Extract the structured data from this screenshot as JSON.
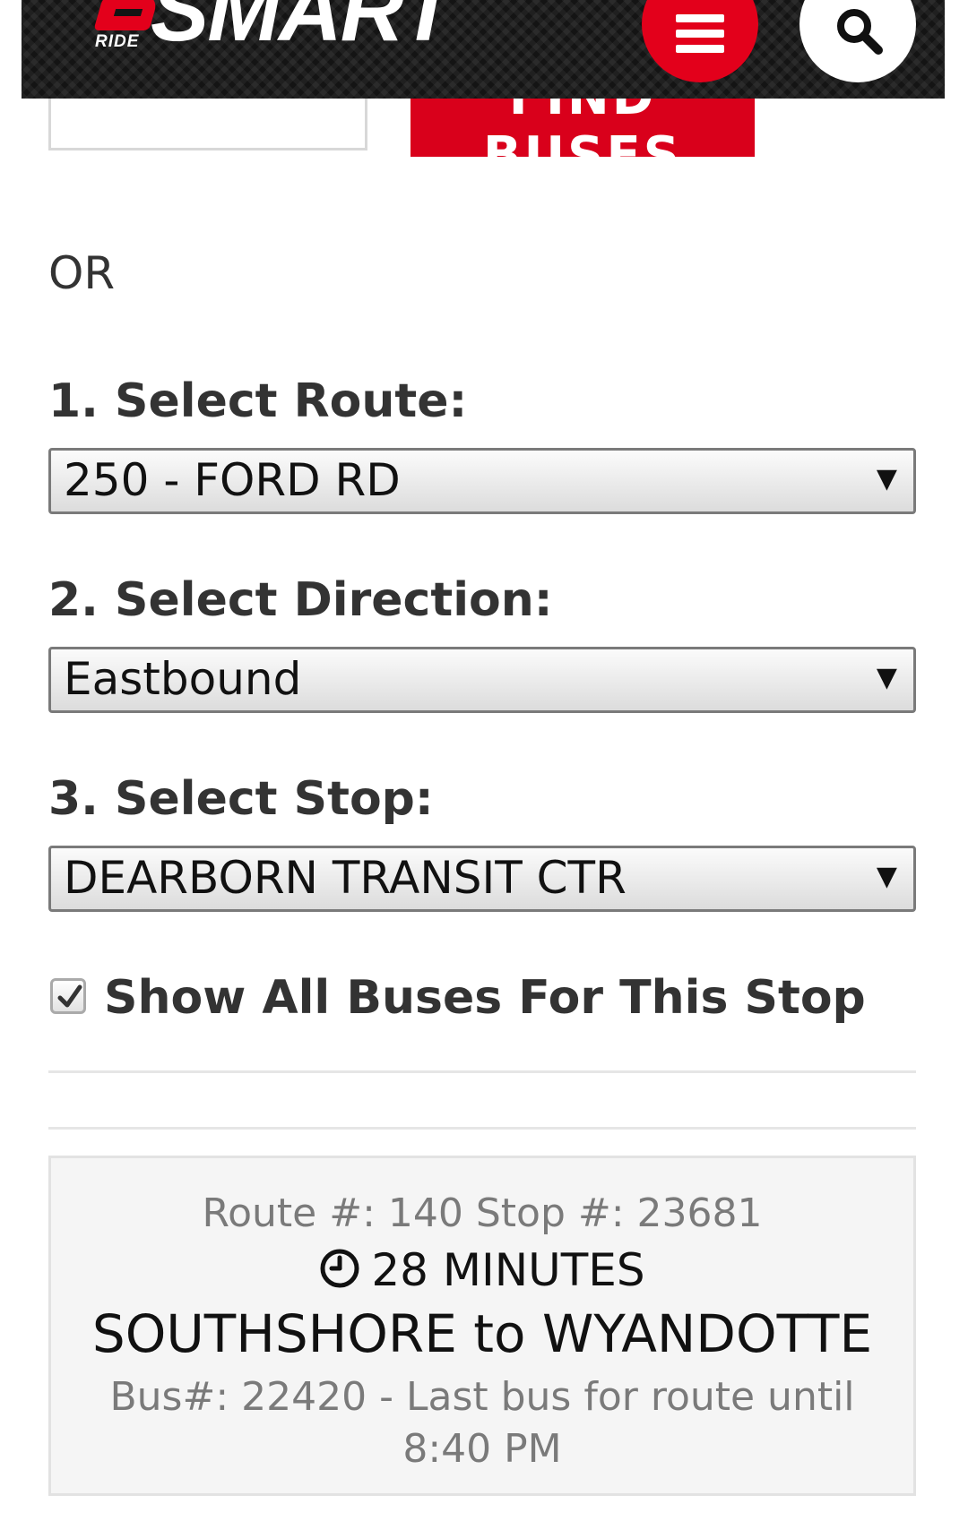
{
  "header": {
    "logo_ride": "RIDE",
    "logo_text": "SMART",
    "menu_icon": "hamburger-menu-icon",
    "search_icon": "search-icon"
  },
  "search": {
    "find_button_label": "FIND BUSES"
  },
  "or_label": "OR",
  "route": {
    "label": "1. Select Route:",
    "selected": "250 - FORD RD"
  },
  "direction": {
    "label": "2. Select Direction:",
    "selected": "Eastbound"
  },
  "stop": {
    "label": "3. Select Stop:",
    "selected": "DEARBORN TRANSIT CTR"
  },
  "show_all": {
    "label": "Show All Buses For This Stop",
    "checked": true
  },
  "result": {
    "route_stop": "Route #: 140 Stop #: 23681",
    "eta": "28 MINUTES",
    "trip": "SOUTHSHORE to WYANDOTTE",
    "bus_info": "Bus#: 22420 - Last bus for route until 8:40 PM"
  },
  "colors": {
    "brand_red": "#d9001b",
    "header_bg": "#141414"
  }
}
